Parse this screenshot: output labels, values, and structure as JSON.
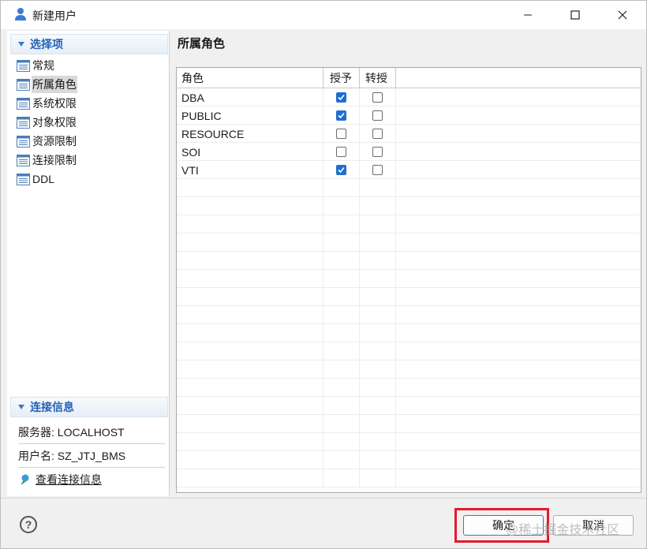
{
  "window": {
    "title": "新建用户"
  },
  "nav": {
    "section_title": "选择项",
    "items": [
      {
        "label": "常规",
        "selected": false
      },
      {
        "label": "所属角色",
        "selected": true
      },
      {
        "label": "系统权限",
        "selected": false
      },
      {
        "label": "对象权限",
        "selected": false
      },
      {
        "label": "资源限制",
        "selected": false
      },
      {
        "label": "连接限制",
        "selected": false
      },
      {
        "label": "DDL",
        "selected": false
      }
    ]
  },
  "connection": {
    "section_title": "连接信息",
    "server": "服务器: LOCALHOST",
    "user": "用户名: SZ_JTJ_BMS",
    "view_link": "查看连接信息"
  },
  "main": {
    "title": "所属角色",
    "table": {
      "headers": [
        "角色",
        "授予",
        "转授"
      ],
      "rows": [
        {
          "role": "DBA",
          "grant": true,
          "regrant": false
        },
        {
          "role": "PUBLIC",
          "grant": true,
          "regrant": false
        },
        {
          "role": "RESOURCE",
          "grant": false,
          "regrant": false
        },
        {
          "role": "SOI",
          "grant": false,
          "regrant": false
        },
        {
          "role": "VTI",
          "grant": true,
          "regrant": false
        }
      ],
      "empty_rows": 17
    }
  },
  "footer": {
    "help": "?",
    "ok_label": "确定",
    "cancel_label": "取消",
    "watermark": "@稀土掘金技术社区"
  },
  "colors": {
    "accent": "#2462b5",
    "checkbox_on": "#1e6fd1",
    "highlight": "#e6192b"
  }
}
